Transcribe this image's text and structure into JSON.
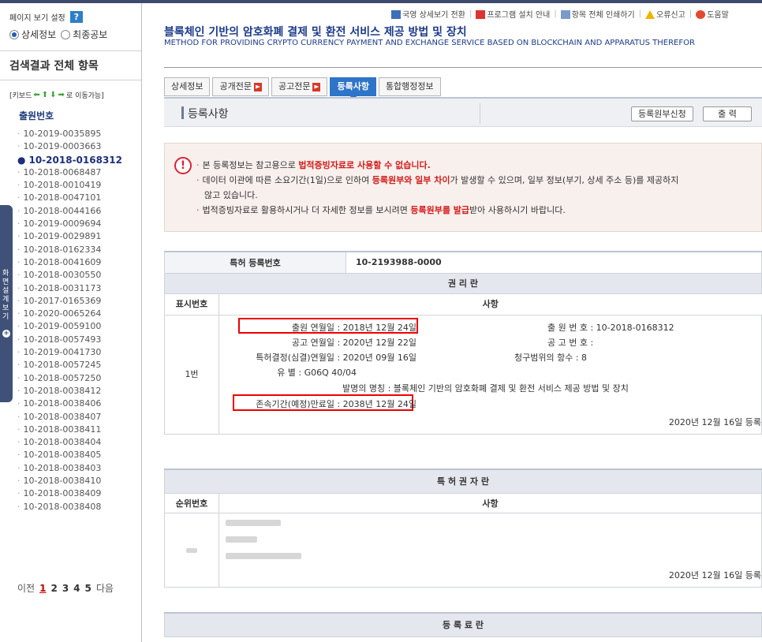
{
  "sidebar": {
    "view_setting_label": "페이지 보기 설정",
    "help_icon_text": "?",
    "radio_detail": "상세정보",
    "radio_final": "최종공보",
    "results_header": "검색결과 전체 항목",
    "key_hint_prefix": "[키보드",
    "key_hint_suffix": "로 이동가능]",
    "list_title": "출원번호",
    "items": [
      "10-2019-0035895",
      "10-2019-0003663",
      "10-2018-0168312",
      "10-2018-0068487",
      "10-2018-0010419",
      "10-2018-0047101",
      "10-2018-0044166",
      "10-2019-0009694",
      "10-2019-0029891",
      "10-2018-0162334",
      "10-2018-0041609",
      "10-2018-0030550",
      "10-2018-0031173",
      "10-2017-0165369",
      "10-2020-0065264",
      "10-2019-0059100",
      "10-2018-0057493",
      "10-2019-0041730",
      "10-2018-0057245",
      "10-2018-0057250",
      "10-2018-0038412",
      "10-2018-0038406",
      "10-2018-0038407",
      "10-2018-0038411",
      "10-2018-0038404",
      "10-2018-0038405",
      "10-2018-0038403",
      "10-2018-0038410",
      "10-2018-0038409",
      "10-2018-0038408"
    ],
    "active_index": 2,
    "pager": {
      "prev": "이전",
      "pages": [
        "1",
        "2",
        "3",
        "4",
        "5"
      ],
      "current": "1",
      "next": "다음"
    },
    "side_tab_text": "화면설계보기"
  },
  "toplinks": [
    "국영 상세보기 전환",
    "프로그램 설치 안내",
    "항목 전체 인쇄하기",
    "오류신고",
    "도움말"
  ],
  "title": {
    "ko": "블록체인 기반의 암호화폐 결제 및 환전 서비스 제공 방법 및 장치",
    "en": "METHOD FOR PROVIDING CRYPTO CURRENCY PAYMENT AND EXCHANGE SERVICE BASED ON BLOCKCHAIN AND APPARATUS THEREFOR"
  },
  "tabs": [
    {
      "label": "상세정보",
      "pdf": false
    },
    {
      "label": "공개전문",
      "pdf": true
    },
    {
      "label": "공고전문",
      "pdf": true
    },
    {
      "label": "등록사항",
      "pdf": false
    },
    {
      "label": "통합행정정보",
      "pdf": false
    }
  ],
  "active_tab": 3,
  "section": {
    "label": "등록사항",
    "btn_request": "등록원부신청",
    "btn_print": "출 력"
  },
  "notice": {
    "line1_a": "본 등록정보는 참고용으로 ",
    "line1_b": "법적증빙자료로 사용할 수 없습니다.",
    "line2_a": "데이터 이관에 따른 소요기간(1일)으로 인하여 ",
    "line2_b": "등록원부와 일부 차이",
    "line2_c": "가 발생할 수 있으며, 일부 정보(부기, 상세 주소 등)를 제공하지",
    "line2_d": "않고 있습니다.",
    "line3_a": "법적증빙자료로 활용하시거나 더 자세한 정보를 보시려면 ",
    "line3_b": "등록원부를 발급",
    "line3_c": "받아 사용하시기 바랍니다."
  },
  "registration": {
    "label": "특허 등록번호",
    "value": "10-2193988-0000",
    "rights_header": "권 리 란",
    "col_display_no": "표시번호",
    "col_matters": "사항",
    "row_no": "1번",
    "filing_date": "출원 연월일 : 2018년 12월 24일",
    "pub_date": "공고 연월일 : 2020년 12월 22일",
    "decision_date": "특허결정(심결)연월일 : 2020년 09월 16일",
    "class": "유 별 : G06Q 40/04",
    "invention_name": "발명의 명칭 : 블록체인 기반의 암호화폐 결제 및 환전 서비스 제공 방법 및 장치",
    "expiry_date": "존속기간(예정)만료일 : 2038년 12월 24일",
    "filing_no": "출 원 번 호 : 10-2018-0168312",
    "pub_no": "공 고 번 호 :",
    "claims": "청구범위의 항수 : 8",
    "reg_note": "2020년 12월 16일 등록"
  },
  "holders": {
    "header": "특 허 권 자 란",
    "col_rank": "순위번호",
    "col_matters": "사항",
    "reg_note": "2020년 12월 16일 등록"
  },
  "fee": {
    "header": "등 록 료 란"
  }
}
